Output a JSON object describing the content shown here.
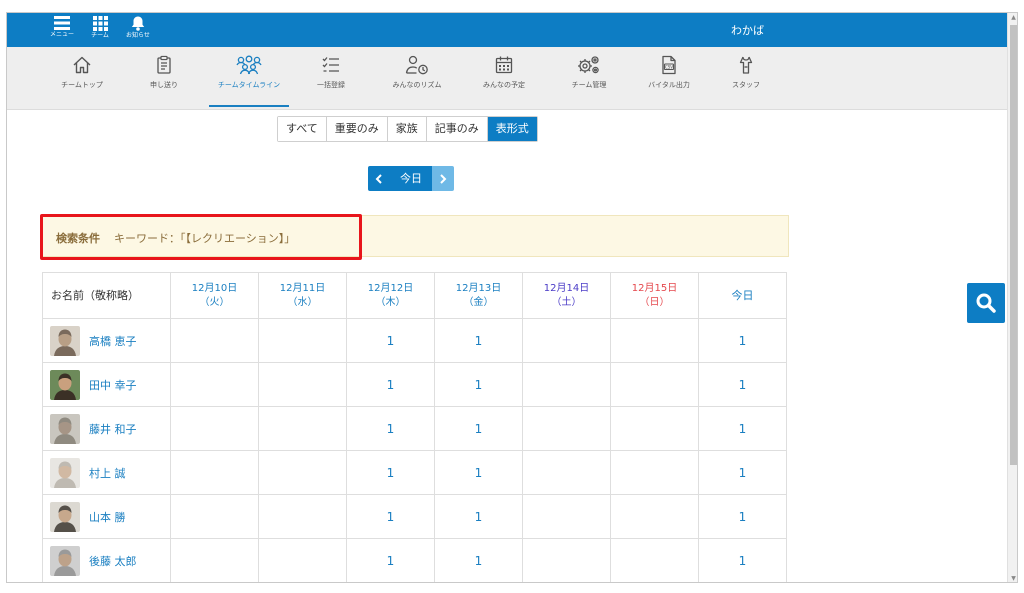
{
  "topbar": {
    "menu_label": "メニュー",
    "team_label": "チーム",
    "notice_label": "お知らせ",
    "site_name": "わかば"
  },
  "nav": [
    {
      "label": "チームトップ",
      "icon": "home-icon"
    },
    {
      "label": "申し送り",
      "icon": "clipboard-icon"
    },
    {
      "label": "チームタイムライン",
      "icon": "team-icon",
      "active": true
    },
    {
      "label": "一括登録",
      "icon": "checklist-icon"
    },
    {
      "label": "みんなのリズム",
      "icon": "person-clock-icon"
    },
    {
      "label": "みんなの予定",
      "icon": "calendar-icon"
    },
    {
      "label": "チーム管理",
      "icon": "gears-icon"
    },
    {
      "label": "バイタル出力",
      "icon": "csv-file-icon"
    },
    {
      "label": "スタッフ",
      "icon": "apron-icon"
    }
  ],
  "filters": [
    "すべて",
    "重要のみ",
    "家族",
    "記事のみ",
    "表形式"
  ],
  "active_filter": "表形式",
  "date_nav": {
    "today_label": "今日"
  },
  "search_condition": {
    "label": "検索条件",
    "text": "キーワード：「【レクリエーション】」"
  },
  "table": {
    "name_header": "お名前（敬称略）",
    "days": [
      {
        "date": "12月10日",
        "dow": "（火）"
      },
      {
        "date": "12月11日",
        "dow": "（水）"
      },
      {
        "date": "12月12日",
        "dow": "（木）"
      },
      {
        "date": "12月13日",
        "dow": "（金）"
      },
      {
        "date": "12月14日",
        "dow": "（土）"
      },
      {
        "date": "12月15日",
        "dow": "（日）"
      }
    ],
    "today_header": "今日",
    "rows": [
      {
        "name": "高橋 恵子",
        "values": [
          "",
          "",
          "1",
          "1",
          "",
          "",
          "1"
        ]
      },
      {
        "name": "田中 幸子",
        "values": [
          "",
          "",
          "1",
          "1",
          "",
          "",
          "1"
        ]
      },
      {
        "name": "藤井 和子",
        "values": [
          "",
          "",
          "1",
          "1",
          "",
          "",
          "1"
        ]
      },
      {
        "name": "村上 誠",
        "values": [
          "",
          "",
          "1",
          "1",
          "",
          "",
          "1"
        ]
      },
      {
        "name": "山本 勝",
        "values": [
          "",
          "",
          "1",
          "1",
          "",
          "",
          "1"
        ]
      },
      {
        "name": "後藤 太郎",
        "values": [
          "",
          "",
          "1",
          "1",
          "",
          "",
          "1"
        ]
      }
    ]
  },
  "colors": {
    "brand": "#0d7dc4",
    "link": "#1a7fc1",
    "saturday": "#4b3cc7",
    "sunday": "#e5484d",
    "highlight_border": "#e8151b",
    "condition_bg": "#fdf8e4"
  }
}
